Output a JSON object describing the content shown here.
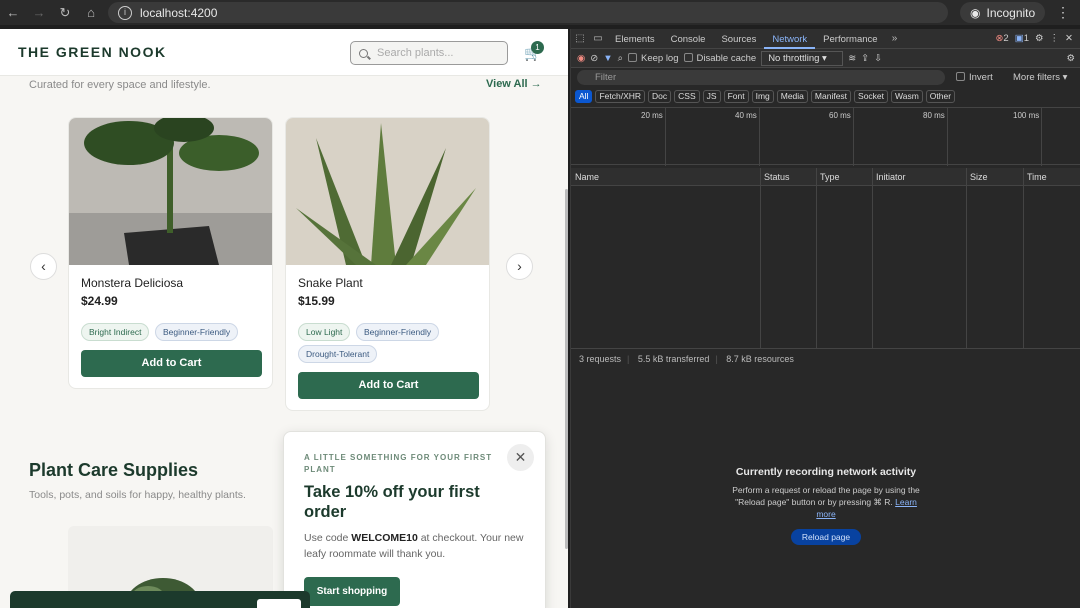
{
  "browser": {
    "url": "localhost:4200",
    "profile": "Incognito"
  },
  "site": {
    "logo": "THE GREEN NOOK",
    "search_placeholder": "Search plants...",
    "cart_count": "1",
    "featured_subtitle": "Curated for every space and lifestyle.",
    "view_all": "View All →",
    "cards": [
      {
        "name": "Monstera Deliciosa",
        "price": "$24.99",
        "tags": [
          "Bright Indirect",
          "Beginner-Friendly"
        ],
        "cta": "Add to Cart"
      },
      {
        "name": "Snake Plant",
        "price": "$15.99",
        "tags": [
          "Low Light",
          "Beginner-Friendly",
          "Drought-Tolerant"
        ],
        "cta": "Add to Cart"
      }
    ],
    "section_title": "Plant Care Supplies",
    "section_subtitle": "Tools, pots, and soils for happy, healthy plants."
  },
  "popup": {
    "kicker": "A LITTLE SOMETHING FOR YOUR FIRST PLANT",
    "title": "Take 10% off your first order",
    "body_before": "Use code ",
    "code": "WELCOME10",
    "body_after": " at checkout. Your new leafy roommate will thank you.",
    "button": "Start shopping"
  },
  "devtools": {
    "tabs": [
      "Elements",
      "Console",
      "Sources",
      "Network",
      "Performance"
    ],
    "active_tab": "Network",
    "errors": "2",
    "messages": "1",
    "keep_log": "Keep log",
    "disable_cache": "Disable cache",
    "throttling": "No throttling",
    "filter_placeholder": "Filter",
    "invert": "Invert",
    "more_filters": "More filters",
    "types": [
      "All",
      "Fetch/XHR",
      "Doc",
      "CSS",
      "JS",
      "Font",
      "Img",
      "Media",
      "Manifest",
      "Socket",
      "Wasm",
      "Other"
    ],
    "timeline_marks": [
      "20 ms",
      "40 ms",
      "60 ms",
      "80 ms",
      "100 ms"
    ],
    "columns": [
      "Name",
      "Status",
      "Type",
      "Initiator",
      "Size",
      "Time"
    ],
    "status": {
      "requests": "3 requests",
      "transferred": "5.5 kB transferred",
      "resources": "8.7 kB resources"
    },
    "empty_title": "Currently recording network activity",
    "empty_body": "Perform a request or reload the page by using the \"Reload page\" button or by pressing ⌘ R.",
    "learn_more": "Learn more",
    "reload": "Reload page"
  }
}
